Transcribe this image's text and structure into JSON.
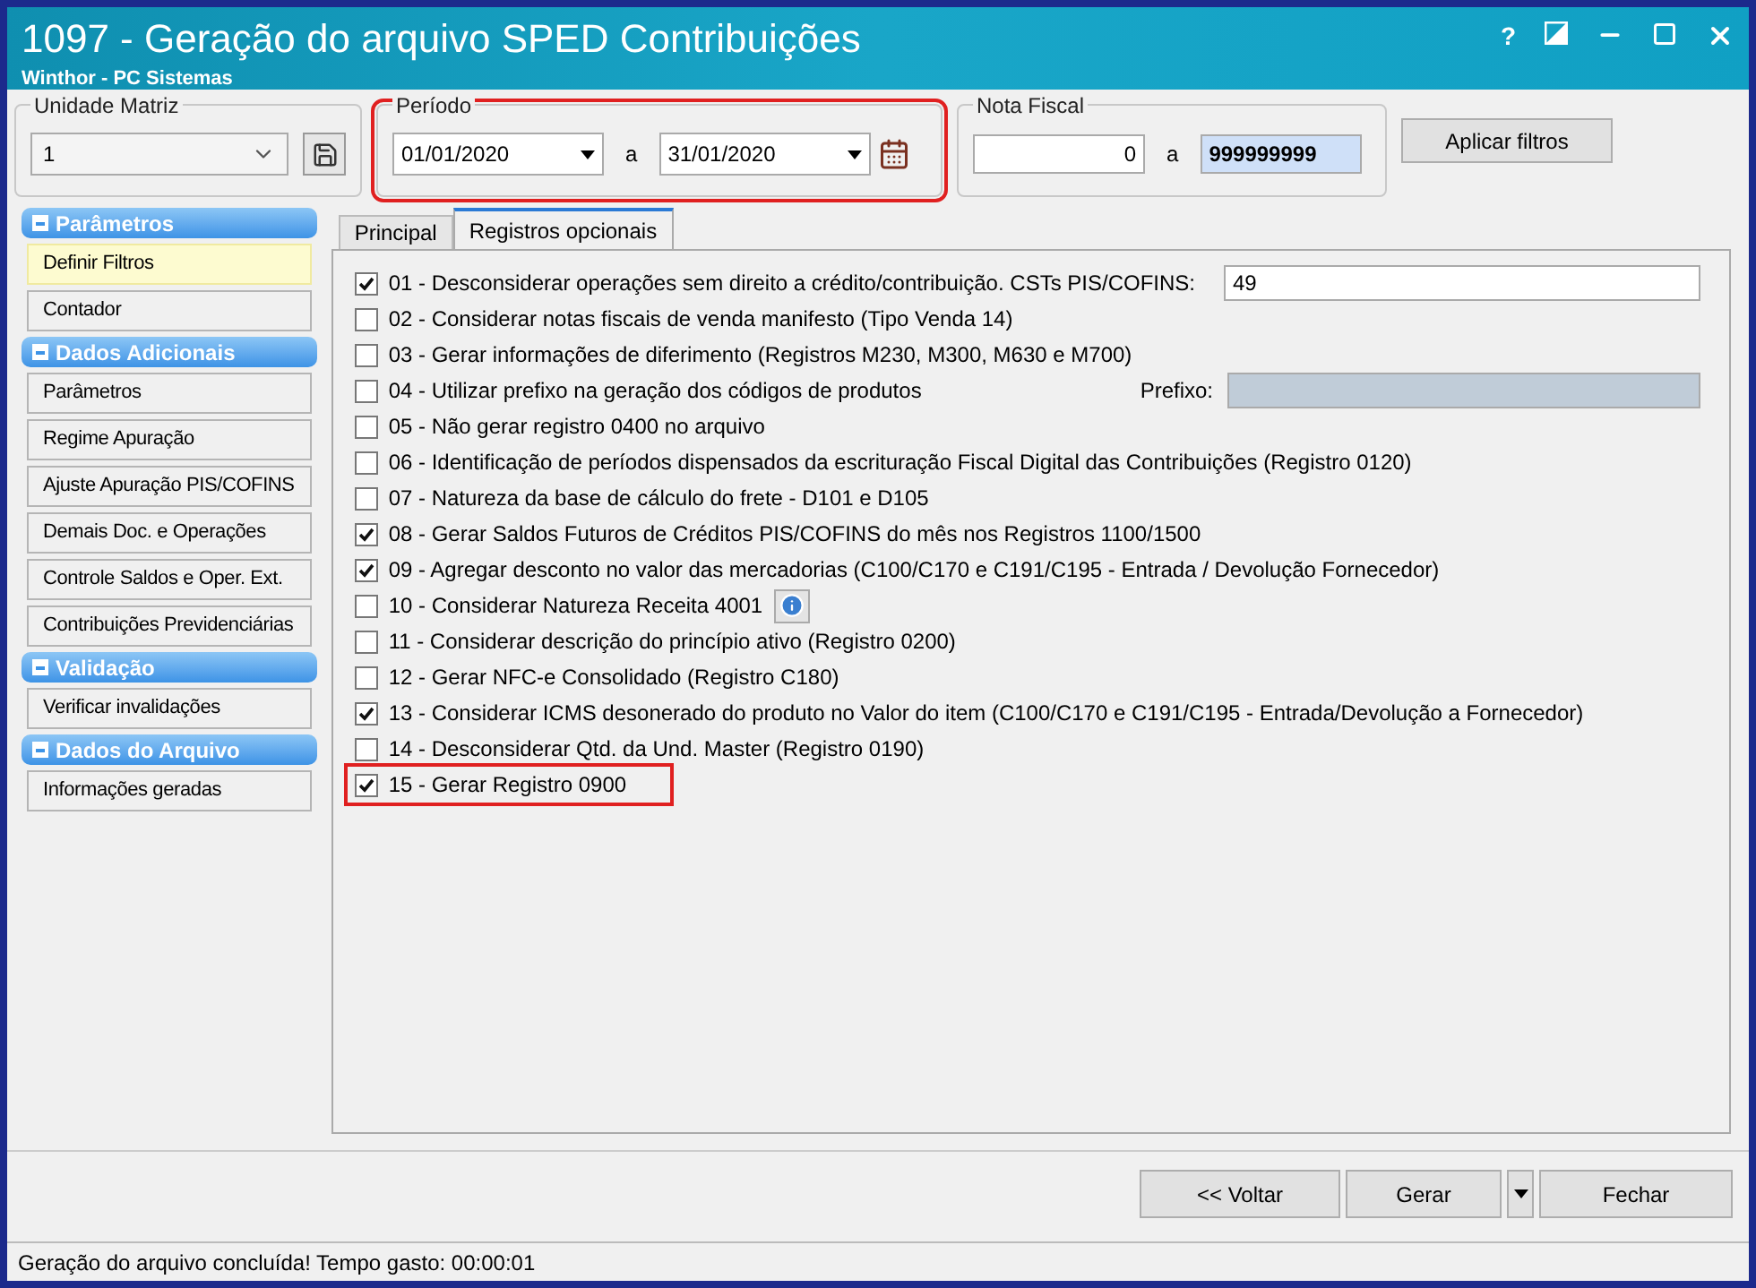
{
  "window": {
    "title": "1097 - Geração do arquivo SPED Contribuições",
    "subtitle": "Winthor - PC Sistemas",
    "help": "?"
  },
  "filters": {
    "unidade": {
      "label": "Unidade Matriz",
      "value": "1"
    },
    "periodo": {
      "label": "Período",
      "from": "01/01/2020",
      "sep": "a",
      "to": "31/01/2020",
      "highlighted": true
    },
    "nota_fiscal": {
      "label": "Nota Fiscal",
      "from": "0",
      "sep": "a",
      "to": "999999999"
    },
    "apply_button": "Aplicar filtros"
  },
  "sidebar": [
    {
      "title": "Parâmetros",
      "items": [
        {
          "label": "Definir Filtros",
          "selected": true
        },
        {
          "label": "Contador",
          "selected": false
        }
      ]
    },
    {
      "title": "Dados Adicionais",
      "items": [
        {
          "label": "Parâmetros",
          "selected": false
        },
        {
          "label": "Regime Apuração",
          "selected": false
        },
        {
          "label": "Ajuste Apuração PIS/COFINS",
          "selected": false
        },
        {
          "label": "Demais Doc. e Operações",
          "selected": false
        },
        {
          "label": "Controle Saldos e Oper. Ext.",
          "selected": false
        },
        {
          "label": "Contribuições Previdenciárias",
          "selected": false
        }
      ]
    },
    {
      "title": "Validação",
      "items": [
        {
          "label": "Verificar invalidações",
          "selected": false
        }
      ]
    },
    {
      "title": "Dados do Arquivo",
      "items": [
        {
          "label": "Informações geradas",
          "selected": false
        }
      ]
    }
  ],
  "tabs": [
    {
      "label": "Principal",
      "selected": false
    },
    {
      "label": "Registros opcionais",
      "selected": true
    }
  ],
  "options": [
    {
      "label": "01 - Desconsiderar operações sem direito a crédito/contribuição. CSTs PIS/COFINS:",
      "checked": true,
      "highlighted": false,
      "kind": "field",
      "value": "49"
    },
    {
      "label": "02 - Considerar notas fiscais de venda manifesto (Tipo Venda 14)",
      "checked": false,
      "highlighted": false,
      "kind": "plain"
    },
    {
      "label": "03 - Gerar informações de diferimento (Registros M230, M300, M630 e M700)",
      "checked": false,
      "highlighted": false,
      "kind": "plain"
    },
    {
      "label": "04 - Utilizar prefixo na geração dos códigos de produtos",
      "checked": false,
      "highlighted": false,
      "kind": "labeled_field",
      "field_label": "Prefixo:",
      "disabled": true
    },
    {
      "label": "05 - Não gerar registro 0400 no arquivo",
      "checked": false,
      "highlighted": false,
      "kind": "plain"
    },
    {
      "label": "06 - Identificação de períodos dispensados da escrituração Fiscal Digital das Contribuições (Registro 0120)",
      "checked": false,
      "highlighted": false,
      "kind": "plain"
    },
    {
      "label": "07 - Natureza da base de cálculo do frete - D101 e D105",
      "checked": false,
      "highlighted": false,
      "kind": "plain"
    },
    {
      "label": "08 - Gerar Saldos Futuros de Créditos PIS/COFINS do mês nos Registros 1100/1500",
      "checked": true,
      "highlighted": false,
      "kind": "plain"
    },
    {
      "label": "09 - Agregar desconto no valor das mercadorias (C100/C170 e C191/C195 - Entrada / Devolução Fornecedor)",
      "checked": true,
      "highlighted": false,
      "kind": "plain"
    },
    {
      "label": "10 - Considerar Natureza Receita 4001",
      "checked": false,
      "highlighted": false,
      "kind": "info"
    },
    {
      "label": "11 - Considerar descrição do princípio ativo (Registro 0200)",
      "checked": false,
      "highlighted": false,
      "kind": "plain"
    },
    {
      "label": "12 - Gerar NFC-e Consolidado (Registro C180)",
      "checked": false,
      "highlighted": false,
      "kind": "plain"
    },
    {
      "label": "13 - Considerar ICMS desonerado do produto no Valor do item (C100/C170 e C191/C195 - Entrada/Devolução a Fornecedor)",
      "checked": true,
      "highlighted": false,
      "kind": "plain"
    },
    {
      "label": "14 - Desconsiderar Qtd. da Und. Master (Registro 0190)",
      "checked": false,
      "highlighted": false,
      "kind": "plain"
    },
    {
      "label": "15 - Gerar Registro 0900",
      "checked": true,
      "highlighted": true,
      "kind": "plain"
    }
  ],
  "buttons": {
    "back": "<< Voltar",
    "generate": "Gerar",
    "close": "Fechar"
  },
  "status_bar": "Geração do arquivo concluída! Tempo gasto: 00:00:01"
}
